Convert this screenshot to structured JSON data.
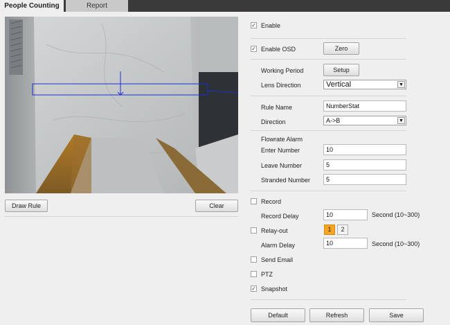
{
  "tabs": [
    {
      "label": "People Counting"
    },
    {
      "label": "Report"
    }
  ],
  "left": {
    "draw_rule_label": "Draw Rule",
    "clear_label": "Clear"
  },
  "settings": {
    "enable": {
      "label": "Enable",
      "checked": true
    },
    "enable_osd": {
      "label": "Enable OSD",
      "checked": true,
      "zero_label": "Zero"
    },
    "working_period": {
      "label": "Working Period",
      "setup_label": "Setup"
    },
    "lens_direction": {
      "label": "Lens Direction",
      "value": "Vertical"
    },
    "rule_name": {
      "label": "Rule Name",
      "value": "NumberStat"
    },
    "direction": {
      "label": "Direction",
      "value": "A->B"
    },
    "flowrate_alarm": {
      "label": "Flowrate Alarm"
    },
    "enter_number": {
      "label": "Enter Number",
      "value": "10"
    },
    "leave_number": {
      "label": "Leave Number",
      "value": "5"
    },
    "stranded_number": {
      "label": "Stranded Number",
      "value": "5"
    },
    "record": {
      "label": "Record",
      "checked": false
    },
    "record_delay": {
      "label": "Record Delay",
      "value": "10",
      "unit": "Second (10~300)"
    },
    "relay_out": {
      "label": "Relay-out",
      "checked": false,
      "channels": [
        "1",
        "2"
      ],
      "active_channel": "1"
    },
    "alarm_delay": {
      "label": "Alarm Delay",
      "value": "10",
      "unit": "Second (10~300)"
    },
    "send_email": {
      "label": "Send Email",
      "checked": false
    },
    "ptz": {
      "label": "PTZ",
      "checked": false
    },
    "snapshot": {
      "label": "Snapshot",
      "checked": true
    }
  },
  "footer": {
    "default_label": "Default",
    "refresh_label": "Refresh",
    "save_label": "Save"
  },
  "colors": {
    "rule_line": "#1c2dd6",
    "active_channel": "#f4a623"
  }
}
